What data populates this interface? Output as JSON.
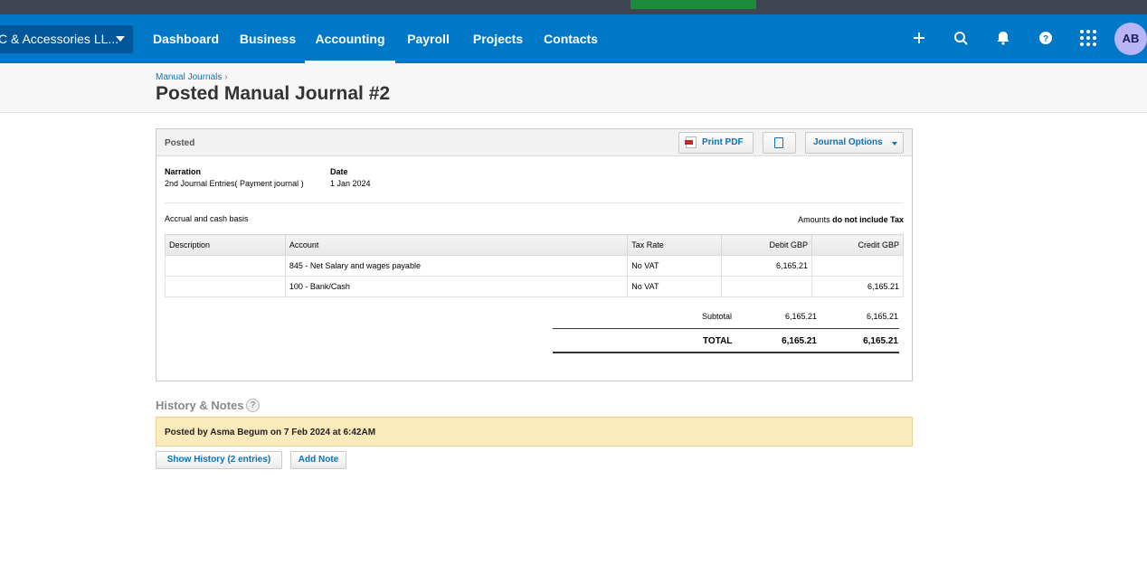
{
  "nav": {
    "org_name": "C & Accessories LL...",
    "links": [
      "Dashboard",
      "Business",
      "Accounting",
      "Payroll",
      "Projects",
      "Contacts"
    ],
    "avatar_initials": "AB"
  },
  "breadcrumb": "Manual Journals",
  "page_title": "Posted Manual Journal #2",
  "journal": {
    "status": "Posted",
    "print_pdf_label": "Print PDF",
    "options_label": "Journal Options",
    "narration_label": "Narration",
    "narration_value": "2nd Journal Entries( Payment journal )",
    "date_label": "Date",
    "date_value": "1 Jan 2024",
    "basis": "Accrual and cash basis",
    "amounts_prefix": "Amounts",
    "amounts_bold": "do not include Tax",
    "columns": [
      "Description",
      "Account",
      "Tax Rate",
      "Debit GBP",
      "Credit GBP"
    ],
    "rows": [
      {
        "description": "",
        "account": "845 - Net Salary and wages payable",
        "tax_rate": "No VAT",
        "debit": "6,165.21",
        "credit": ""
      },
      {
        "description": "",
        "account": "100 - Bank/Cash",
        "tax_rate": "No VAT",
        "debit": "",
        "credit": "6,165.21"
      }
    ],
    "subtotal_label": "Subtotal",
    "subtotal_debit": "6,165.21",
    "subtotal_credit": "6,165.21",
    "total_label": "TOTAL",
    "total_debit": "6,165.21",
    "total_credit": "6,165.21"
  },
  "history": {
    "title": "History & Notes",
    "help": "?",
    "posted_note": "Posted by Asma Begum on 7 Feb 2024 at 6:42AM",
    "show_history_label": "Show History (2 entries)",
    "add_note_label": "Add Note"
  },
  "colors": {
    "nav_bg": "#0078c8",
    "link": "#0b74b6",
    "note_bg": "#fbeabc"
  }
}
